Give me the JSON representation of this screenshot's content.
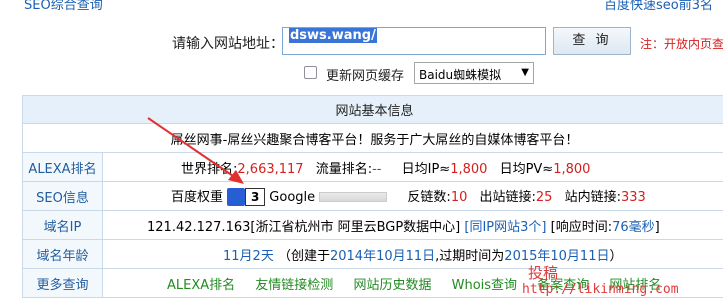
{
  "topbar": {
    "left": "SEO综合查询",
    "right": "百度快速seo前3名"
  },
  "query": {
    "label": "请输入网站地址：",
    "url_value": "dsws.wang/",
    "button": "查 询",
    "note": "注：开放内页查"
  },
  "options": {
    "cache_label": "更新网页缓存",
    "ua_selected": "Baidu蜘蛛模拟"
  },
  "table": {
    "title": "网站基本信息",
    "site_desc": "屌丝网事-屌丝兴趣聚合博客平台！服务于广大屌丝的自媒体博客平台！",
    "alexa": {
      "label": "ALEXA排名",
      "world_rank_label": "世界排名:",
      "world_rank": "2,663,117",
      "traffic_label": "流量排名:",
      "traffic": "--",
      "daily_ip_label": "日均IP≈",
      "daily_ip": "1,800",
      "daily_pv_label": "日均PV≈",
      "daily_pv": "1,800"
    },
    "seo": {
      "label": "SEO信息",
      "baidu_weight_label": "百度权重",
      "baidu_weight": "3",
      "google_label": "Google",
      "backlinks_label": "反链数:",
      "backlinks": "10",
      "outlinks_label": "出站链接:",
      "outlinks": "25",
      "inlinks_label": "站内链接:",
      "inlinks": "333"
    },
    "ip": {
      "label": "域名IP",
      "address": "121.42.127.163[浙江省杭州市 阿里云BGP数据中心]",
      "same_ip": "[同IP网站3个]",
      "response_label": "[响应时间:",
      "response": "76毫秒",
      "response_close": "]"
    },
    "age": {
      "label": "域名年龄",
      "age": "11月2天",
      "created_prefix": "（创建于",
      "created": "2014年10月11日",
      "expire_prefix": ",过期时间为",
      "expire": "2015年10月11日",
      "close": "）"
    },
    "more": {
      "label": "更多查询",
      "links": [
        "ALEXA排名",
        "友情链接检测",
        "网站历史数据",
        "Whois查询",
        "备案查询",
        "网站排名"
      ]
    }
  },
  "watermark": {
    "cn": "投稿",
    "url": "http://likinming.com"
  },
  "colors": {
    "accent": "#1a5fb4",
    "value_red": "#d42020",
    "link_green": "#228b22",
    "arrow": "#e03030"
  }
}
